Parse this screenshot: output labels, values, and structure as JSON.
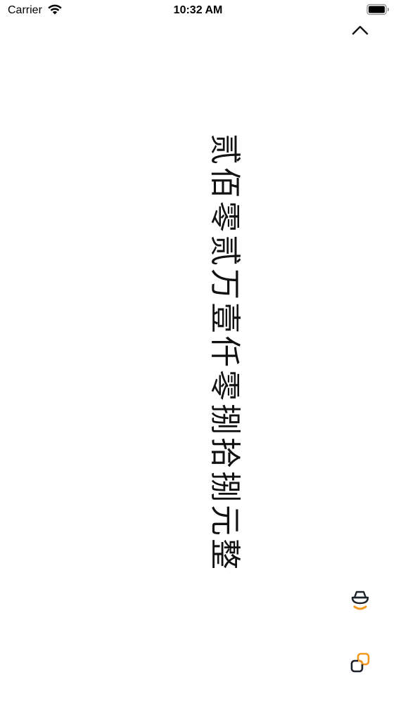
{
  "status_bar": {
    "carrier": "Carrier",
    "time": "10:32 AM"
  },
  "main": {
    "amount_text": "贰佰零贰万壹仟零捌拾捌元整"
  },
  "icons": {
    "wifi": "wifi-icon",
    "battery": "battery-icon",
    "collapse": "chevron-up-icon",
    "speak": "speaker-icon",
    "copy": "copy-icon"
  },
  "colors": {
    "accent": "#F39A1E",
    "icon_dark": "#1E232B",
    "background": "#FFFFFF",
    "text": "#111111"
  }
}
